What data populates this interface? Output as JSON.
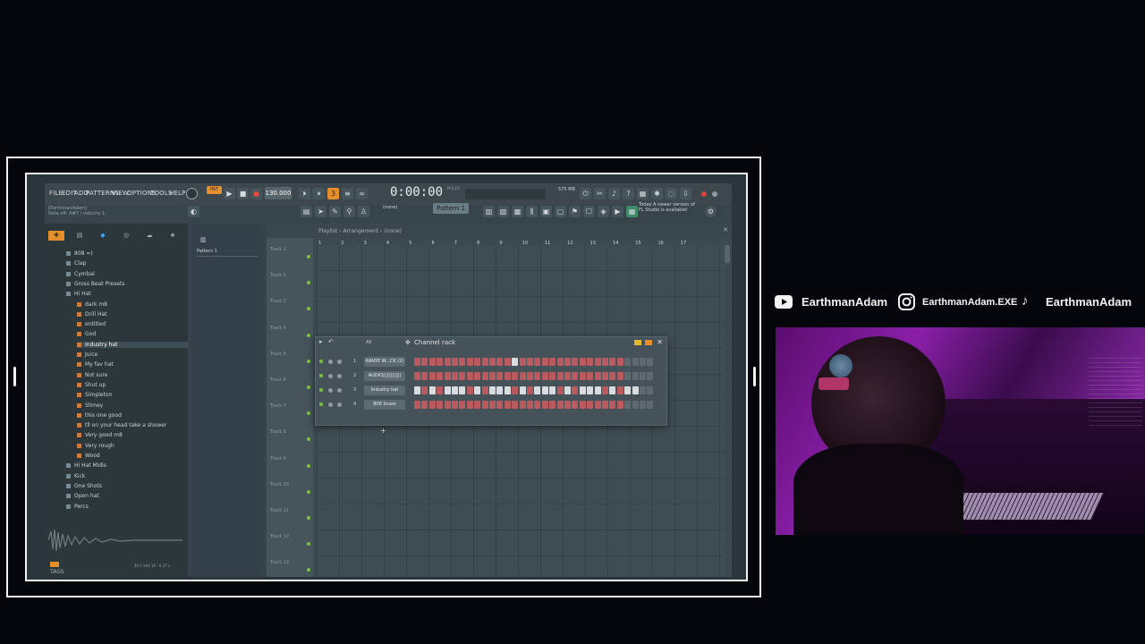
{
  "app": {
    "menu": [
      "FILE",
      "EDIT",
      "ADD",
      "PATTERNS",
      "VIEW",
      "OPTIONS",
      "TOOLS",
      "HELP"
    ],
    "hint_user": "[EarthmanAdam]",
    "hint_text": "Note off: A#7 / velocity 1:",
    "tempo": "130.000",
    "time": "0:00:00",
    "time_unit": "M:S:CS",
    "cpu": "575 MB",
    "pattern_button": "Pattern 1",
    "none_selector": "(none)",
    "news_line1": "Today  A newer version of",
    "news_line2": "FL Studio is available!"
  },
  "browser": {
    "items": [
      {
        "label": "808 =)",
        "type": "folder"
      },
      {
        "label": "Clap",
        "type": "folder"
      },
      {
        "label": "Cymbal",
        "type": "folder"
      },
      {
        "label": "Gross Beat Presets",
        "type": "folder"
      },
      {
        "label": "Hi Hat",
        "type": "folder"
      },
      {
        "label": "dark m8",
        "type": "file"
      },
      {
        "label": "Drill Hat",
        "type": "file"
      },
      {
        "label": "entitled",
        "type": "file"
      },
      {
        "label": "God",
        "type": "file"
      },
      {
        "label": "Industry hat",
        "type": "file-selected"
      },
      {
        "label": "Juice",
        "type": "file"
      },
      {
        "label": "My fav hat",
        "type": "file"
      },
      {
        "label": "Not sure",
        "type": "file"
      },
      {
        "label": "Shut up",
        "type": "file"
      },
      {
        "label": "Simpleton",
        "type": "file"
      },
      {
        "label": "Slimey",
        "type": "file"
      },
      {
        "label": "this one good",
        "type": "file"
      },
      {
        "label": "tll on your head take a shower",
        "type": "file"
      },
      {
        "label": "Very good m8",
        "type": "file"
      },
      {
        "label": "Very rough",
        "type": "file"
      },
      {
        "label": "Wood",
        "type": "file"
      },
      {
        "label": "Hi Hat Midis",
        "type": "folder"
      },
      {
        "label": "Kick",
        "type": "folder"
      },
      {
        "label": "One Shots",
        "type": "folder"
      },
      {
        "label": "Open hat",
        "type": "folder"
      },
      {
        "label": "Percs",
        "type": "folder"
      }
    ],
    "footer": "TAGS",
    "sample_info": "44.1 kHz 16 · 0.27 s"
  },
  "picker": {
    "pattern": "Pattern 1"
  },
  "playlist": {
    "breadcrumb": "Playlist › Arrangement › (none)",
    "ruler": [
      "1",
      "2",
      "3",
      "4",
      "5",
      "6",
      "7",
      "8",
      "9",
      "10",
      "11",
      "12",
      "13",
      "14",
      "15",
      "16",
      "17"
    ],
    "tracks": [
      "Track 1",
      "Track 2",
      "Track 3",
      "Track 4",
      "Track 5",
      "Track 6",
      "Track 7",
      "Track 8",
      "Track 9",
      "Track 10",
      "Track 11",
      "Track 12",
      "Track 13"
    ]
  },
  "channel_rack": {
    "title": "Channel rack",
    "filter": "All",
    "channels": [
      {
        "num": "1",
        "name": "KANYE W...CK (2)",
        "steps": [
          0,
          0,
          0,
          0,
          0,
          0,
          0,
          0,
          0,
          0,
          0,
          0,
          0,
          1,
          0,
          0,
          0,
          0,
          0,
          0,
          0,
          0,
          0,
          0,
          0,
          0,
          0,
          0,
          0,
          0,
          0,
          0
        ]
      },
      {
        "num": "2",
        "name": "AUDIO||||||||||||",
        "steps": [
          0,
          0,
          0,
          0,
          0,
          0,
          0,
          0,
          0,
          0,
          0,
          0,
          0,
          0,
          0,
          0,
          0,
          0,
          0,
          0,
          0,
          0,
          0,
          0,
          0,
          0,
          0,
          0,
          0,
          0,
          0,
          0
        ]
      },
      {
        "num": "3",
        "name": "Industry hat",
        "steps": [
          1,
          0,
          1,
          0,
          1,
          1,
          1,
          0,
          1,
          0,
          1,
          1,
          1,
          0,
          1,
          0,
          1,
          1,
          1,
          0,
          1,
          0,
          1,
          1,
          1,
          0,
          1,
          0,
          1,
          1,
          0,
          0
        ]
      },
      {
        "num": "4",
        "name": "808 Snare",
        "steps": [
          0,
          0,
          0,
          0,
          0,
          0,
          0,
          0,
          0,
          0,
          0,
          0,
          0,
          0,
          0,
          0,
          0,
          0,
          0,
          0,
          0,
          0,
          0,
          0,
          0,
          0,
          0,
          0,
          0,
          0,
          0,
          0
        ]
      }
    ]
  },
  "social": {
    "youtube": "EarthmanAdam",
    "instagram": "EarthmanAdam.EXE",
    "tiktok": "EarthmanAdam"
  }
}
